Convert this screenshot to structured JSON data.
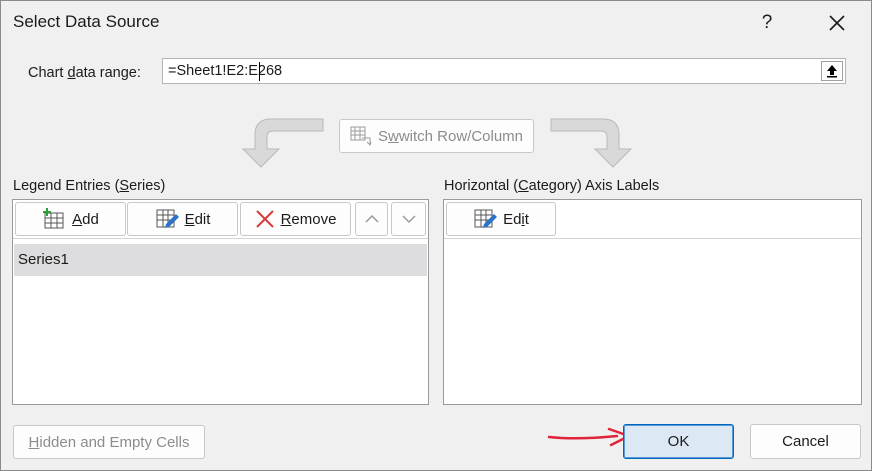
{
  "dialog": {
    "title": "Select Data Source",
    "help": "?",
    "close": "✕"
  },
  "range": {
    "label_pre": "Chart ",
    "label_u": "d",
    "label_post": "ata range:",
    "value": "=Sheet1!E2:E268"
  },
  "switch": {
    "pre": "S",
    "post": "witch Row/Column",
    "u": "w"
  },
  "legend": {
    "label_pre": "Legend Entries (",
    "label_u": "S",
    "label_post": "eries)",
    "add_u": "A",
    "add_rest": "dd",
    "edit_u": "E",
    "edit_rest": "dit",
    "remove_u": "R",
    "remove_rest": "emove",
    "items": [
      "Series1"
    ]
  },
  "axis": {
    "label_pre": "Horizontal (",
    "label_u": "C",
    "label_post": "ategory) Axis Labels",
    "edit_pre": "Ed",
    "edit_u": "i",
    "edit_post": "t"
  },
  "footer": {
    "hidden_u": "H",
    "hidden_rest": "idden and Empty Cells",
    "ok": "OK",
    "cancel": "Cancel"
  },
  "colors": {
    "accent": "#0067c0",
    "arrow": "#e0243a",
    "icon_blue": "#2c73c8",
    "remove_red": "#d83b3b"
  }
}
